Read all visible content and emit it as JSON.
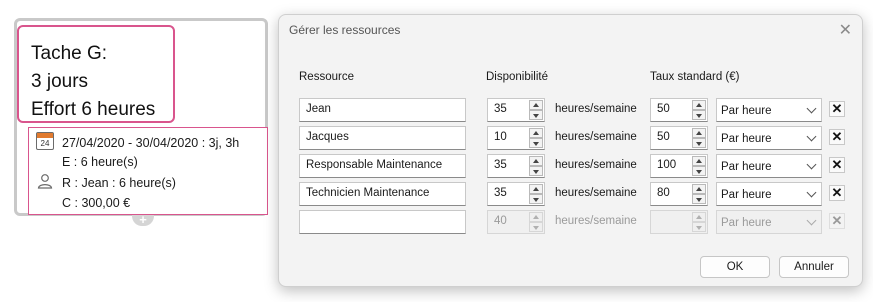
{
  "task_card": {
    "title_lines": [
      "Tache G:",
      "3 jours",
      "Effort 6 heures"
    ],
    "calendar_day": "24",
    "dates": "27/04/2020 - 30/04/2020 : 3j, 3h",
    "effort": "E : 6 heure(s)",
    "resource": "R : Jean : 6 heure(s)",
    "cost": "C : 300,00 €",
    "add_symbol": "+"
  },
  "dialog": {
    "title": "Gérer les ressources",
    "close_glyph": "✕",
    "headers": {
      "resource": "Ressource",
      "availability": "Disponibilité",
      "rate": "Taux standard (€)"
    },
    "rows": [
      {
        "resource": "Jean",
        "availability": "35",
        "unit": "heures/semaine",
        "rate": "50",
        "rate_unit": "Par heure",
        "delete": "✕"
      },
      {
        "resource": "Jacques",
        "availability": "10",
        "unit": "heures/semaine",
        "rate": "50",
        "rate_unit": "Par heure",
        "delete": "✕"
      },
      {
        "resource": "Responsable Maintenance",
        "availability": "35",
        "unit": "heures/semaine",
        "rate": "100",
        "rate_unit": "Par heure",
        "delete": "✕"
      },
      {
        "resource": "Technicien Maintenance",
        "availability": "35",
        "unit": "heures/semaine",
        "rate": "80",
        "rate_unit": "Par heure",
        "delete": "✕"
      }
    ],
    "new_row": {
      "resource": "",
      "availability": "40",
      "unit": "heures/semaine",
      "rate": "",
      "rate_unit": "Par heure",
      "delete": "✕"
    },
    "ok_label": "OK",
    "cancel_label": "Annuler"
  }
}
